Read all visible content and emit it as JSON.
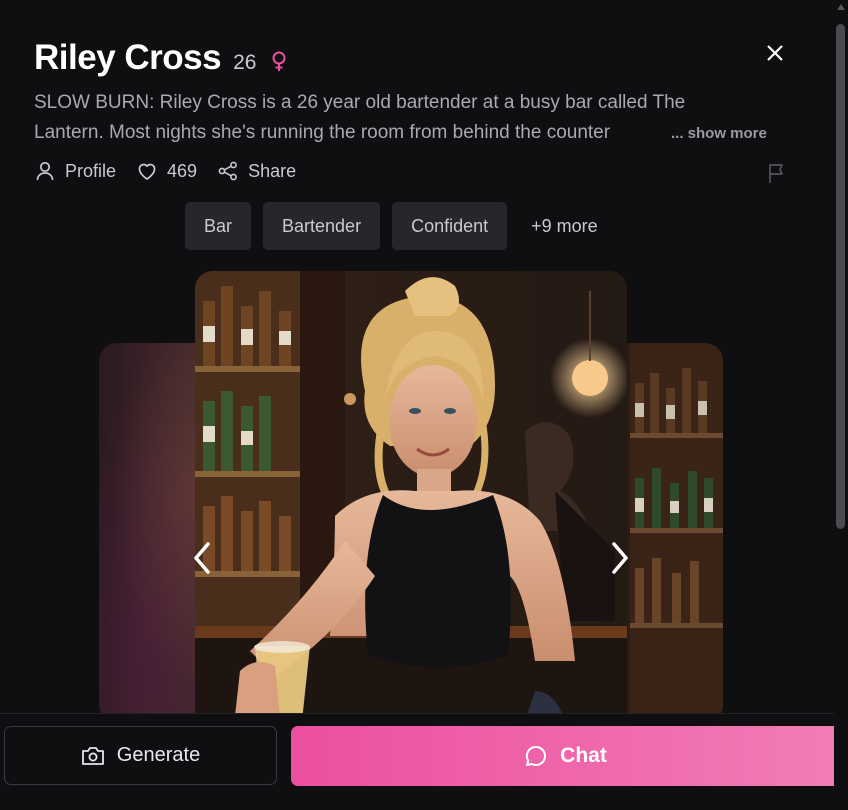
{
  "character": {
    "name": "Riley Cross",
    "age": "26",
    "description_line1": "SLOW BURN: Riley Cross is a 26 year old bartender at a busy bar called The",
    "description_line2": "Lantern. Most nights she's running the room from behind the counter",
    "show_more": "... show more"
  },
  "actions": {
    "profile": "Profile",
    "likes": "469",
    "share": "Share"
  },
  "tags": [
    "Bar",
    "Bartender",
    "Confident",
    "+9 more"
  ],
  "footer": {
    "generate": "Generate",
    "chat": "Chat"
  },
  "colors": {
    "accent": "#ec4f9e",
    "gender": "#ec4f9e",
    "background": "#0f0f12"
  },
  "icons": [
    "gender-female-icon",
    "close-icon",
    "user-icon",
    "heart-icon",
    "share-icon",
    "flag-icon",
    "chevron-left-icon",
    "chevron-right-icon",
    "camera-icon",
    "chat-bubble-icon"
  ]
}
